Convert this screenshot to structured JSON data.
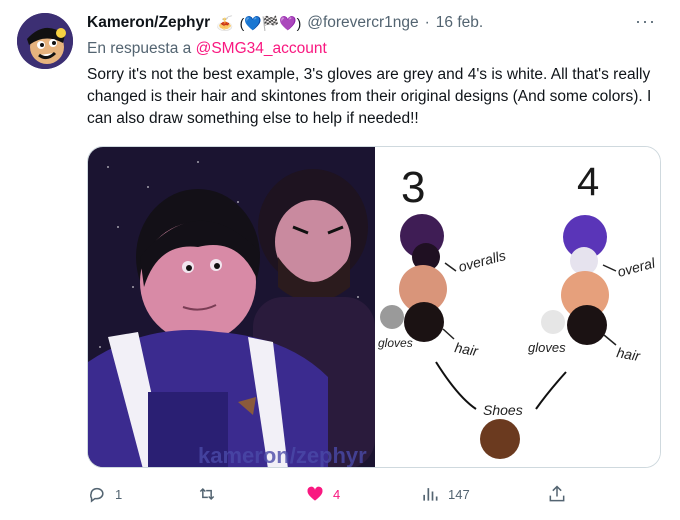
{
  "tweet": {
    "display_name": "Kameron/Zephyr",
    "name_emojis": [
      "🍝",
      "(💙🏁💜)"
    ],
    "handle": "@forevercr1nge",
    "separator": "·",
    "date": "16 feb.",
    "reply_prefix": "En respuesta a",
    "reply_to": "@SMG34_account",
    "text": "Sorry it's not the best example, 3's gloves are grey and 4's is white. All that's really changed is their hair and skintones from their original designs (And some colors). I can also draw something else to help if needed!!",
    "more_icon": "more-horizontal-icon"
  },
  "image": {
    "watermark": "kameron/zephyr",
    "ref_3": {
      "number": "3",
      "labels": {
        "overalls": "overalls",
        "gloves": "gloves",
        "hair": "hair"
      },
      "colors": {
        "overalls": "#3f1d55",
        "overalls_dark": "#1f1022",
        "skin": "#d9957a",
        "hair": "#1b1213",
        "gloves": "#9a9a9a"
      }
    },
    "ref_4": {
      "number": "4",
      "labels": {
        "overalls": "overal",
        "gloves": "gloves",
        "hair": "hair"
      },
      "colors": {
        "overalls": "#5a35b8",
        "overalls_light": "#e6e3ee",
        "skin": "#e6a07c",
        "hair": "#1b1213",
        "gloves": "#e6e6e6"
      }
    },
    "shoes": {
      "label": "Shoes",
      "color": "#6b3a1f"
    }
  },
  "actions": {
    "reply": {
      "icon": "reply-icon",
      "count": "1"
    },
    "retweet": {
      "icon": "retweet-icon",
      "count": ""
    },
    "like": {
      "icon": "heart-icon",
      "count": "4",
      "color": "#f91880"
    },
    "views": {
      "icon": "views-icon",
      "count": "147"
    },
    "share": {
      "icon": "share-icon",
      "count": ""
    }
  }
}
